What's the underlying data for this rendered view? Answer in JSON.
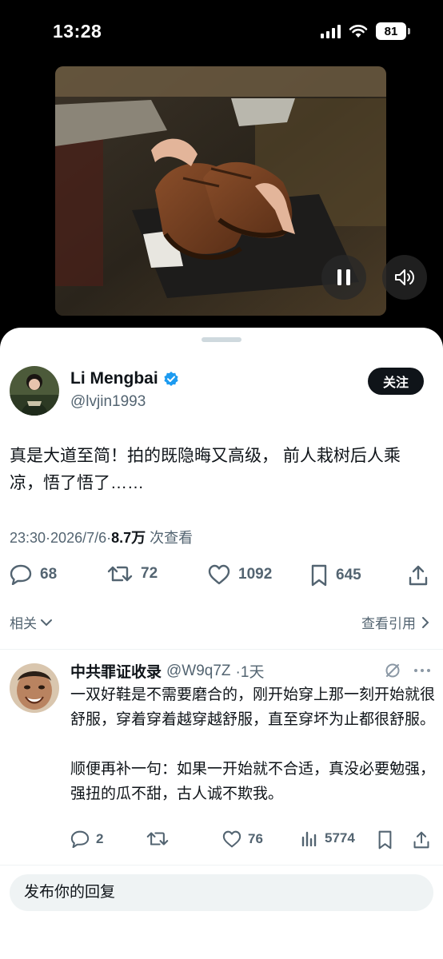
{
  "status_bar": {
    "time": "13:28",
    "battery": "81",
    "icons": [
      "signal-icon",
      "wifi-icon",
      "battery-icon"
    ]
  },
  "video": {
    "controls": [
      "pause-icon",
      "volume-icon"
    ]
  },
  "author": {
    "name": "Li Mengbai",
    "handle": "@lvjin1993",
    "verified": true,
    "follow_label": "关注"
  },
  "tweet": {
    "text": "真是大道至简！拍的既隐晦又高级， 前人栽树后人乘凉，悟了悟了……",
    "time": "23:30",
    "date": "2026/7/6",
    "views_count": "8.7万",
    "views_label": "次查看",
    "separator": "·"
  },
  "stats": {
    "replies": "68",
    "retweets": "72",
    "likes": "1092",
    "bookmarks": "645"
  },
  "links": {
    "related": "相关",
    "view_quotes": "查看引用"
  },
  "reply": {
    "name": "中共罪证收录",
    "handle": "@W9q7Z",
    "time": "·1天",
    "paragraphs": [
      "一双好鞋是不需要磨合的，刚开始穿上那一刻开始就很舒服，穿着穿着越穿越舒服，直至穿坏为止都很舒服。",
      "顺便再补一句：如果一开始就不合适，真没必要勉强，强扭的瓜不甜，古人诚不欺我。"
    ],
    "stats": {
      "replies": "2",
      "retweets": "",
      "likes": "76",
      "views": "5774"
    }
  },
  "compose": {
    "placeholder": "发布你的回复"
  },
  "colors": {
    "accent": "#1d9bf0",
    "text": "#0f1419",
    "muted": "#536471"
  }
}
